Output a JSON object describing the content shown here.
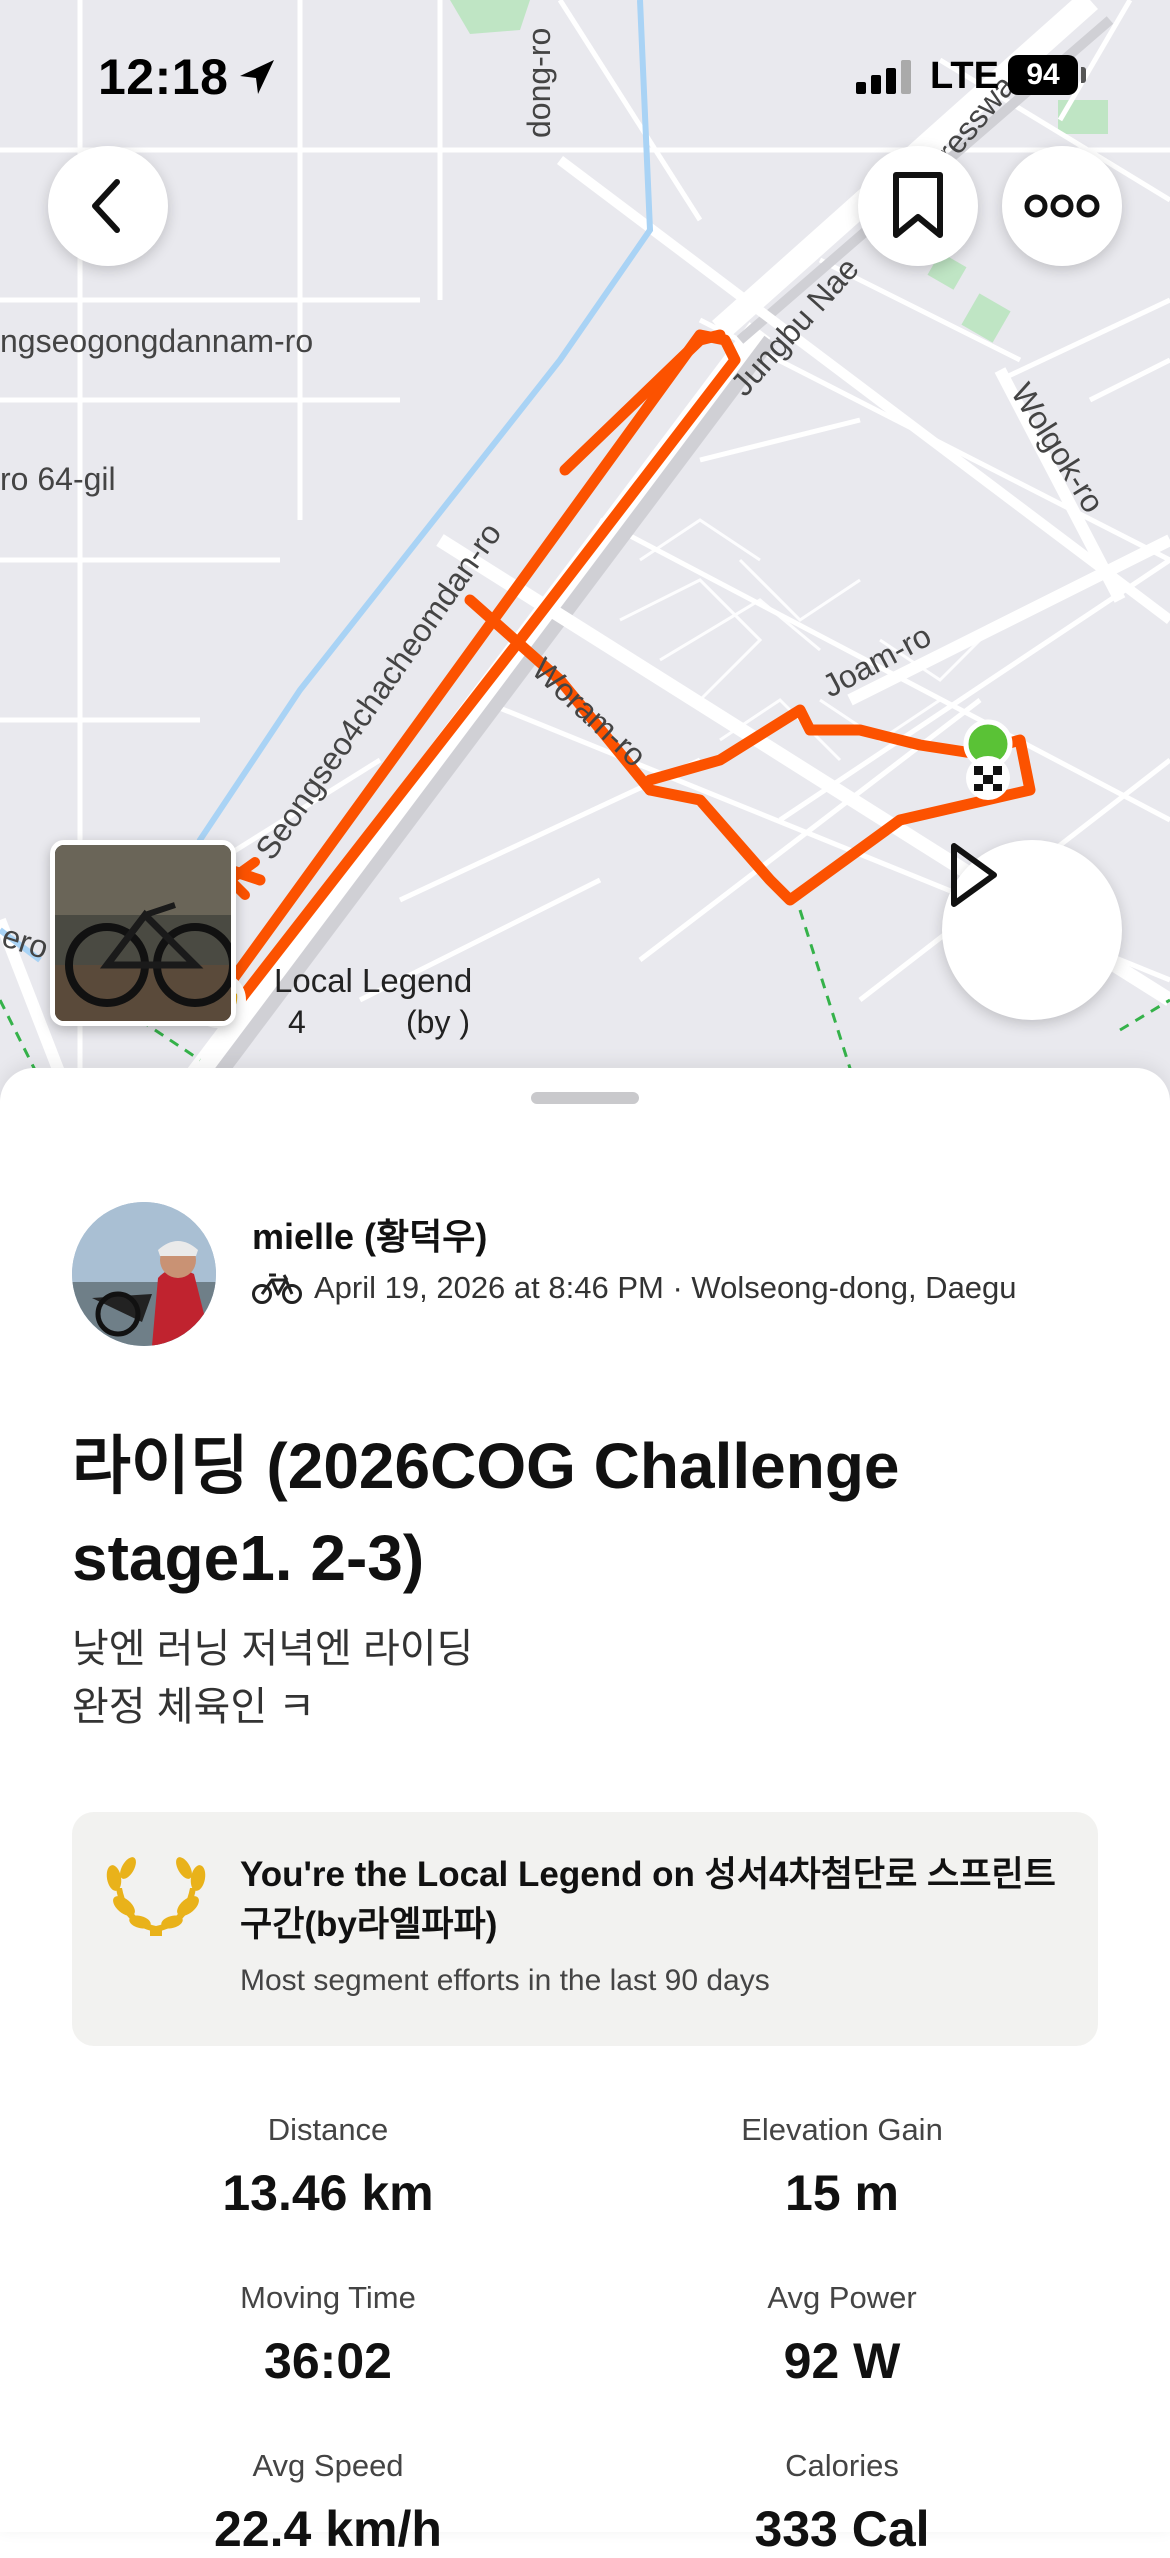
{
  "status_bar": {
    "time": "12:18",
    "network": "LTE",
    "battery": "94"
  },
  "map": {
    "street_labels": {
      "dong_ro": "dong-ro",
      "seongseogongdannam_ro": "ngseogongdannam-ro",
      "ro_64_gil": "ro 64-gil",
      "jungbu_naeryuk": "Jungbu Nae",
      "expressway": "presswa",
      "wolgok_ro": "Wolgok-ro",
      "seongseo4": "Seongseo4chacheomdan-ro",
      "woram_ro": "Woram-ro",
      "joam_ro": "Joam-ro",
      "ero": "ero"
    },
    "local_legend_label": "Local Legend",
    "local_legend_count": "4",
    "local_legend_by": "(by )",
    "colors": {
      "route": "#fc5200",
      "road": "#ffffff",
      "background": "#e9e9ee",
      "water": "#a9d3f5",
      "park": "#bfe5c4",
      "start": "#5ac236"
    }
  },
  "activity": {
    "athlete_name": "mielle (황덕우)",
    "datetime_location": "April 19, 2026 at 8:46 PM · Wolseong-dong, Daegu",
    "sport_icon": "bike-icon",
    "title": "라이딩 (2026COG Challenge stage1. 2-3)",
    "description_line1": "낮엔 러닝 저녁엔 라이딩",
    "description_line2": "완정 체육인 ㅋ"
  },
  "local_legend": {
    "icon": "laurel-icon",
    "title": "You're the Local Legend on 성서4차첨단로 스프린트 구간(by라엘파파)",
    "subtitle": "Most segment efforts in the last 90 days",
    "accent": "#e9b21a"
  },
  "stats": {
    "distance": {
      "label": "Distance",
      "value": "13.46 km"
    },
    "elevation": {
      "label": "Elevation Gain",
      "value": "15 m"
    },
    "moving_time": {
      "label": "Moving Time",
      "value": "36:02"
    },
    "avg_power": {
      "label": "Avg Power",
      "value": "92 W"
    },
    "avg_speed": {
      "label": "Avg Speed",
      "value": "22.4 km/h"
    },
    "calories": {
      "label": "Calories",
      "value": "333 Cal"
    }
  }
}
